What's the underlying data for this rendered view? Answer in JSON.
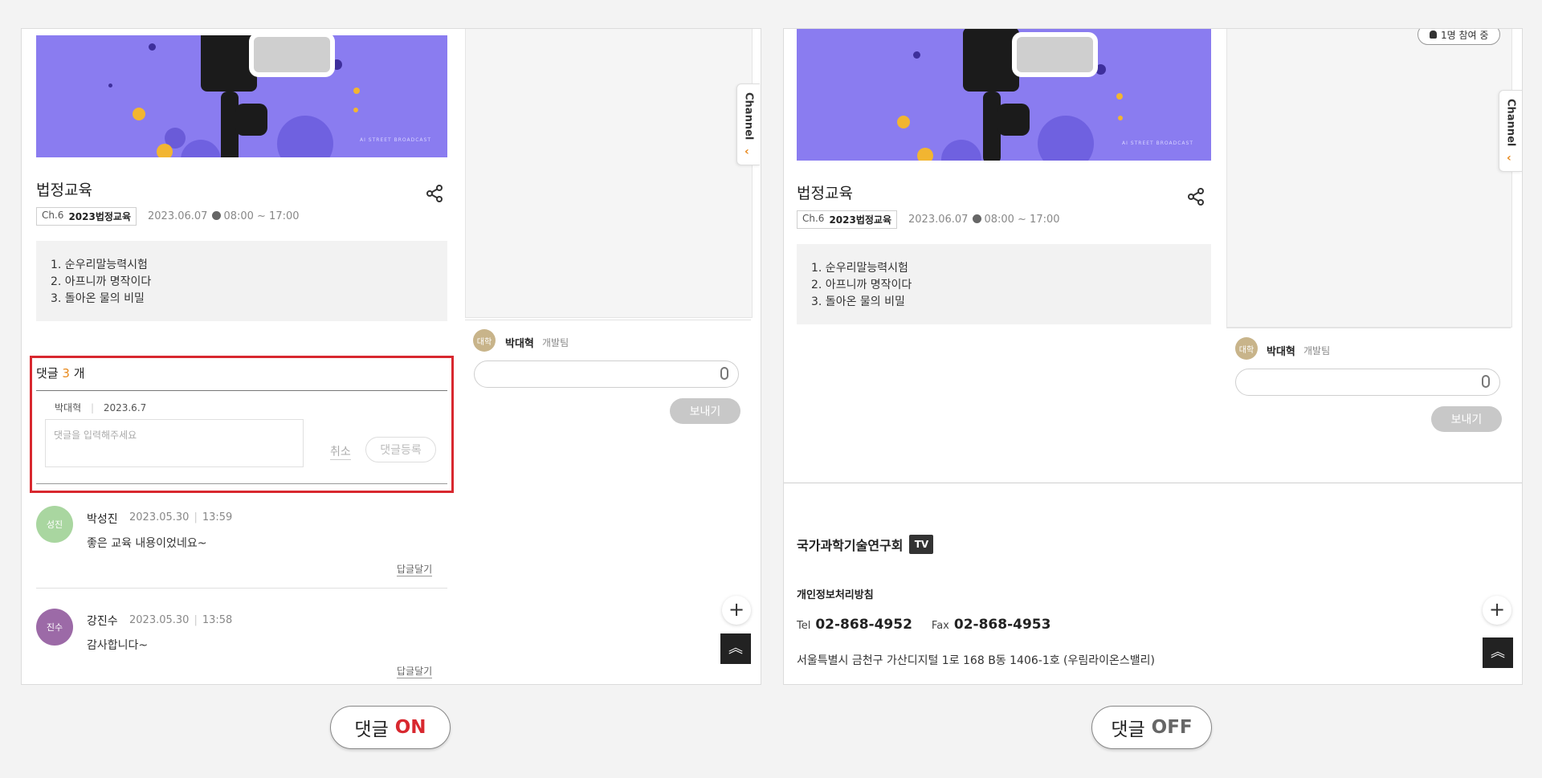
{
  "colors": {
    "banner": "#8a7cf0",
    "accent_red": "#d8282f",
    "accent_orange": "#e8891c"
  },
  "video": {
    "title": "법정교육",
    "channel_no": "Ch.6",
    "channel_name": "2023법정교육",
    "date": "2023.06.07",
    "time": "08:00 ~ 17:00",
    "agenda": [
      "1. 순우리말능력시험",
      "2. 아프니까 명작이다",
      "3. 돌아온 물의 비밀"
    ],
    "banner_watermark": "AI STREET BROADCAST"
  },
  "chat": {
    "avatar_text": "대학",
    "user_name": "박대혁",
    "team": "개발팀",
    "send_label": "보내기",
    "channel_tab": "Channel",
    "live_badge": "1명 참여 중"
  },
  "comments": {
    "header_prefix": "댓글",
    "count": "3",
    "header_suffix": "개",
    "writer": "박대혁",
    "writer_date": "2023.6.7",
    "placeholder": "댓글을 입력해주세요",
    "cancel_label": "취소",
    "register_label": "댓글등록",
    "items": [
      {
        "avatar_text": "성진",
        "avatar_color": "#a9d6a0",
        "name": "박성진",
        "date": "2023.05.30",
        "time": "13:59",
        "text": "좋은 교육 내용이었네요~",
        "reply_label": "답글달기"
      },
      {
        "avatar_text": "진수",
        "avatar_color": "#9c6aa7",
        "name": "강진수",
        "date": "2023.05.30",
        "time": "13:58",
        "text": "감사합니다~",
        "reply_label": "답글달기"
      }
    ]
  },
  "footer": {
    "org": "국가과학기술연구회",
    "tv_logo": "TV",
    "privacy": "개인정보처리방침",
    "tel_label": "Tel",
    "tel": "02-868-4952",
    "fax_label": "Fax",
    "fax": "02-868-4953",
    "address": "서울특별시 금천구 가산디지털 1로 168 B동 1406-1호 (우림라이온스밸리)"
  },
  "toggles": {
    "on_prefix": "댓글",
    "on_state": "ON",
    "off_prefix": "댓글",
    "off_state": "OFF"
  },
  "icons": {
    "plus": "+",
    "top": "︽",
    "channel_chevron": "‹"
  }
}
